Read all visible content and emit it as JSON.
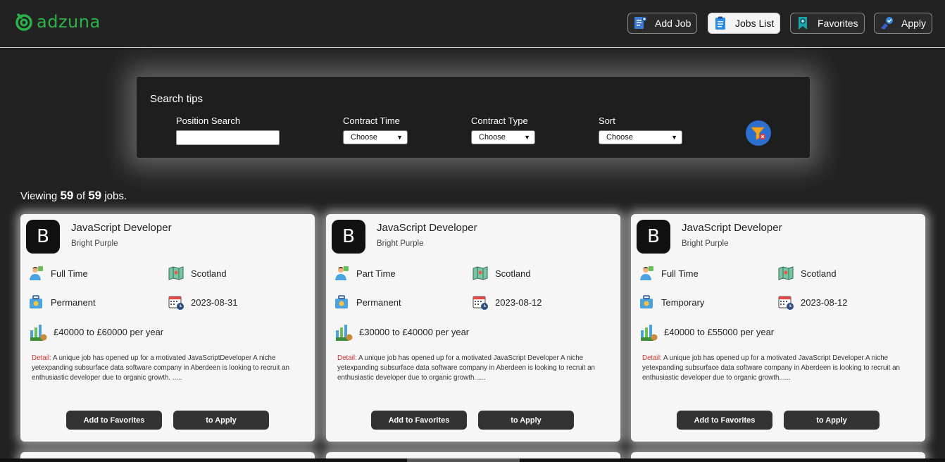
{
  "brand": {
    "name": "adzuna",
    "color": "#2bb34a"
  },
  "nav": [
    {
      "label": "Add Job",
      "icon": "add-document-icon",
      "active": false
    },
    {
      "label": "Jobs List",
      "icon": "clipboard-list-icon",
      "active": true
    },
    {
      "label": "Favorites",
      "icon": "bookmark-plus-icon",
      "active": false
    },
    {
      "label": "Apply",
      "icon": "hand-check-icon",
      "active": false
    }
  ],
  "search": {
    "title": "Search tips",
    "position_label": "Position Search",
    "position_value": "",
    "contract_time_label": "Contract Time",
    "contract_time_value": "Choose",
    "contract_type_label": "Contract Type",
    "contract_type_value": "Choose",
    "sort_label": "Sort",
    "sort_value": "Choose",
    "clear_icon": "filter-clear-icon"
  },
  "viewing": {
    "prefix": "Viewing",
    "shown": "59",
    "of": "of",
    "total": "59",
    "suffix": "jobs."
  },
  "jobs": [
    {
      "initial": "B",
      "title": "JavaScript Developer",
      "company": "Bright Purple",
      "contract_time": "Full Time",
      "location": "Scotland",
      "contract_type": "Permanent",
      "date": "2023-08-31",
      "salary": "£40000 to £60000 per year",
      "detail_label": "Detail:",
      "detail": "A unique job has opened up for a motivated JavaScriptDeveloper A niche yetexpanding subsurface data software company in Aberdeen is looking to recruit an enthusiastic developer due to organic growth. .....",
      "fav_label": "Add to Favorites",
      "apply_label": "to Apply"
    },
    {
      "initial": "B",
      "title": "JavaScript Developer",
      "company": "Bright Purple",
      "contract_time": "Part Time",
      "location": "Scotland",
      "contract_type": "Permanent",
      "date": "2023-08-12",
      "salary": "£30000 to £40000 per year",
      "detail_label": "Detail:",
      "detail": "A unique job has opened up for a motivated JavaScript Developer A niche yetexpanding subsurface data software company in Aberdeen is looking to recruit an enthusiastic developer due to organic growth......",
      "fav_label": "Add to Favorites",
      "apply_label": "to Apply"
    },
    {
      "initial": "B",
      "title": "JavaScript Developer",
      "company": "Bright Purple",
      "contract_time": "Full Time",
      "location": "Scotland",
      "contract_type": "Temporary",
      "date": "2023-08-12",
      "salary": "£40000 to £55000 per year",
      "detail_label": "Detail:",
      "detail": "A unique job has opened up for a motivated JavaScript Developer A niche yetexpanding subsurface data software company in Aberdeen is looking to recruit an enthusiastic developer due to organic growth......",
      "fav_label": "Add to Favorites",
      "apply_label": "to Apply"
    }
  ]
}
